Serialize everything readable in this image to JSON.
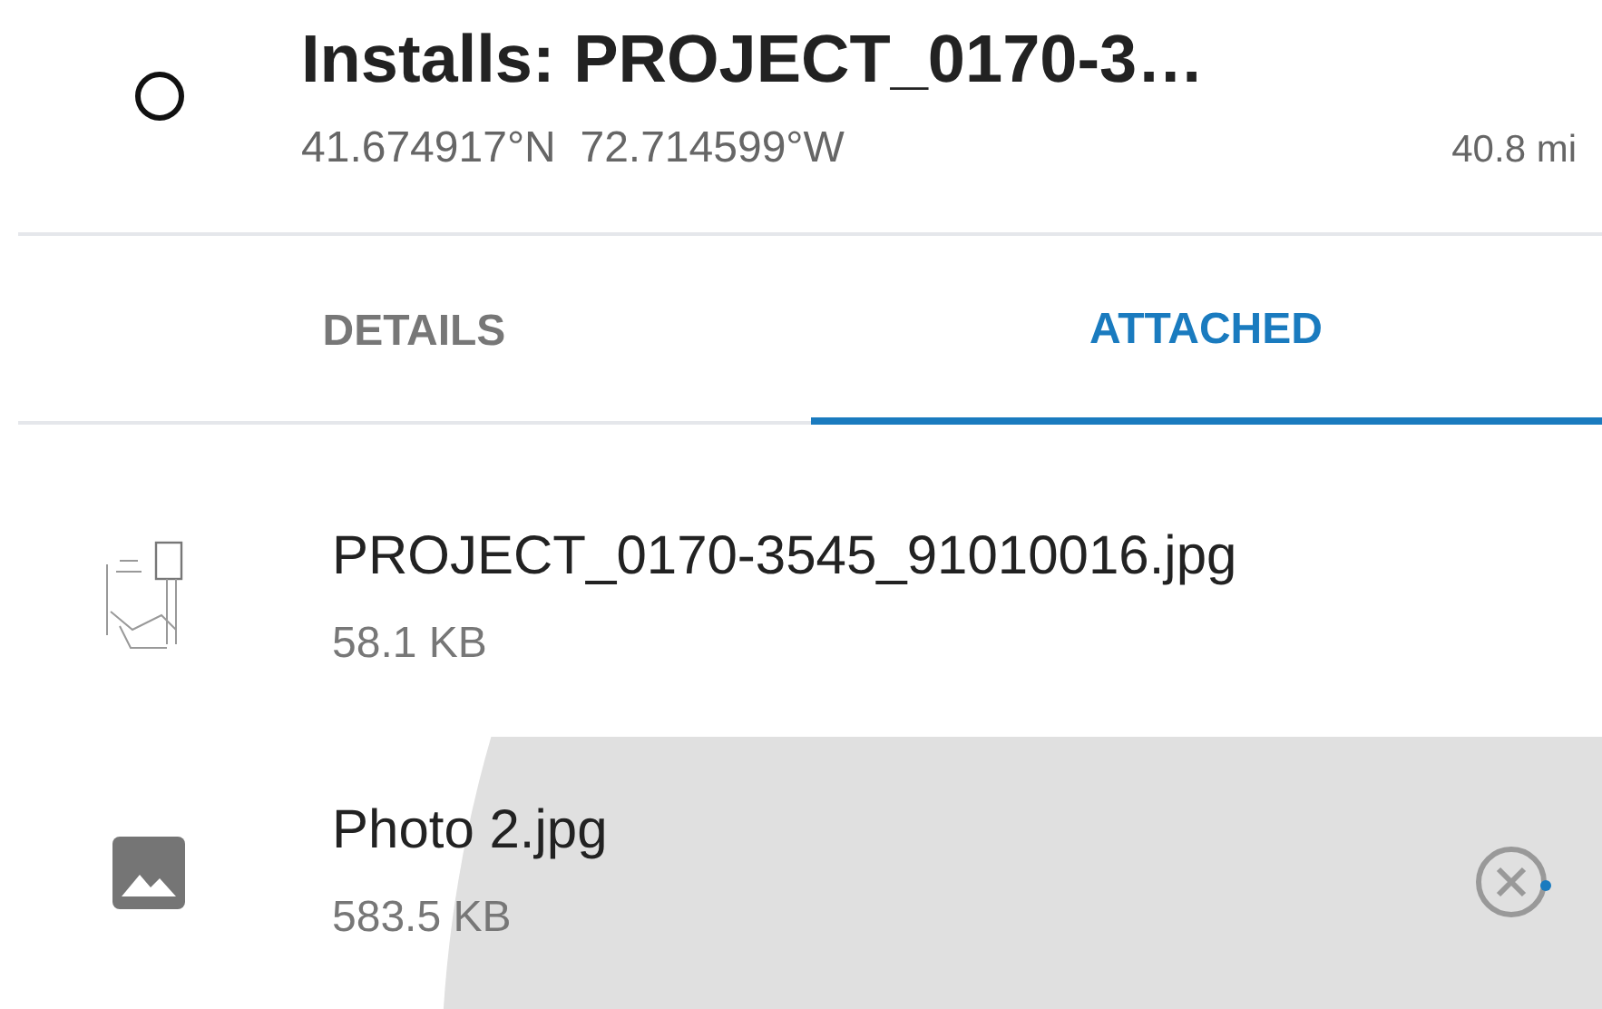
{
  "header": {
    "title": "Installs: PROJECT_0170-3…",
    "coordinates": "41.674917°N  72.714599°W",
    "distance": "40.8 mi"
  },
  "tabs": [
    {
      "label": "DETAILS",
      "selected": false
    },
    {
      "label": "ATTACHED",
      "selected": true
    }
  ],
  "attachments": [
    {
      "kind": "thumbnail",
      "name": "PROJECT_0170-3545_91010016.jpg",
      "size": "58.1 KB",
      "pressed": false,
      "uploading": false
    },
    {
      "kind": "image",
      "name": "Photo 2.jpg",
      "size": "583.5 KB",
      "pressed": true,
      "uploading": true
    }
  ]
}
